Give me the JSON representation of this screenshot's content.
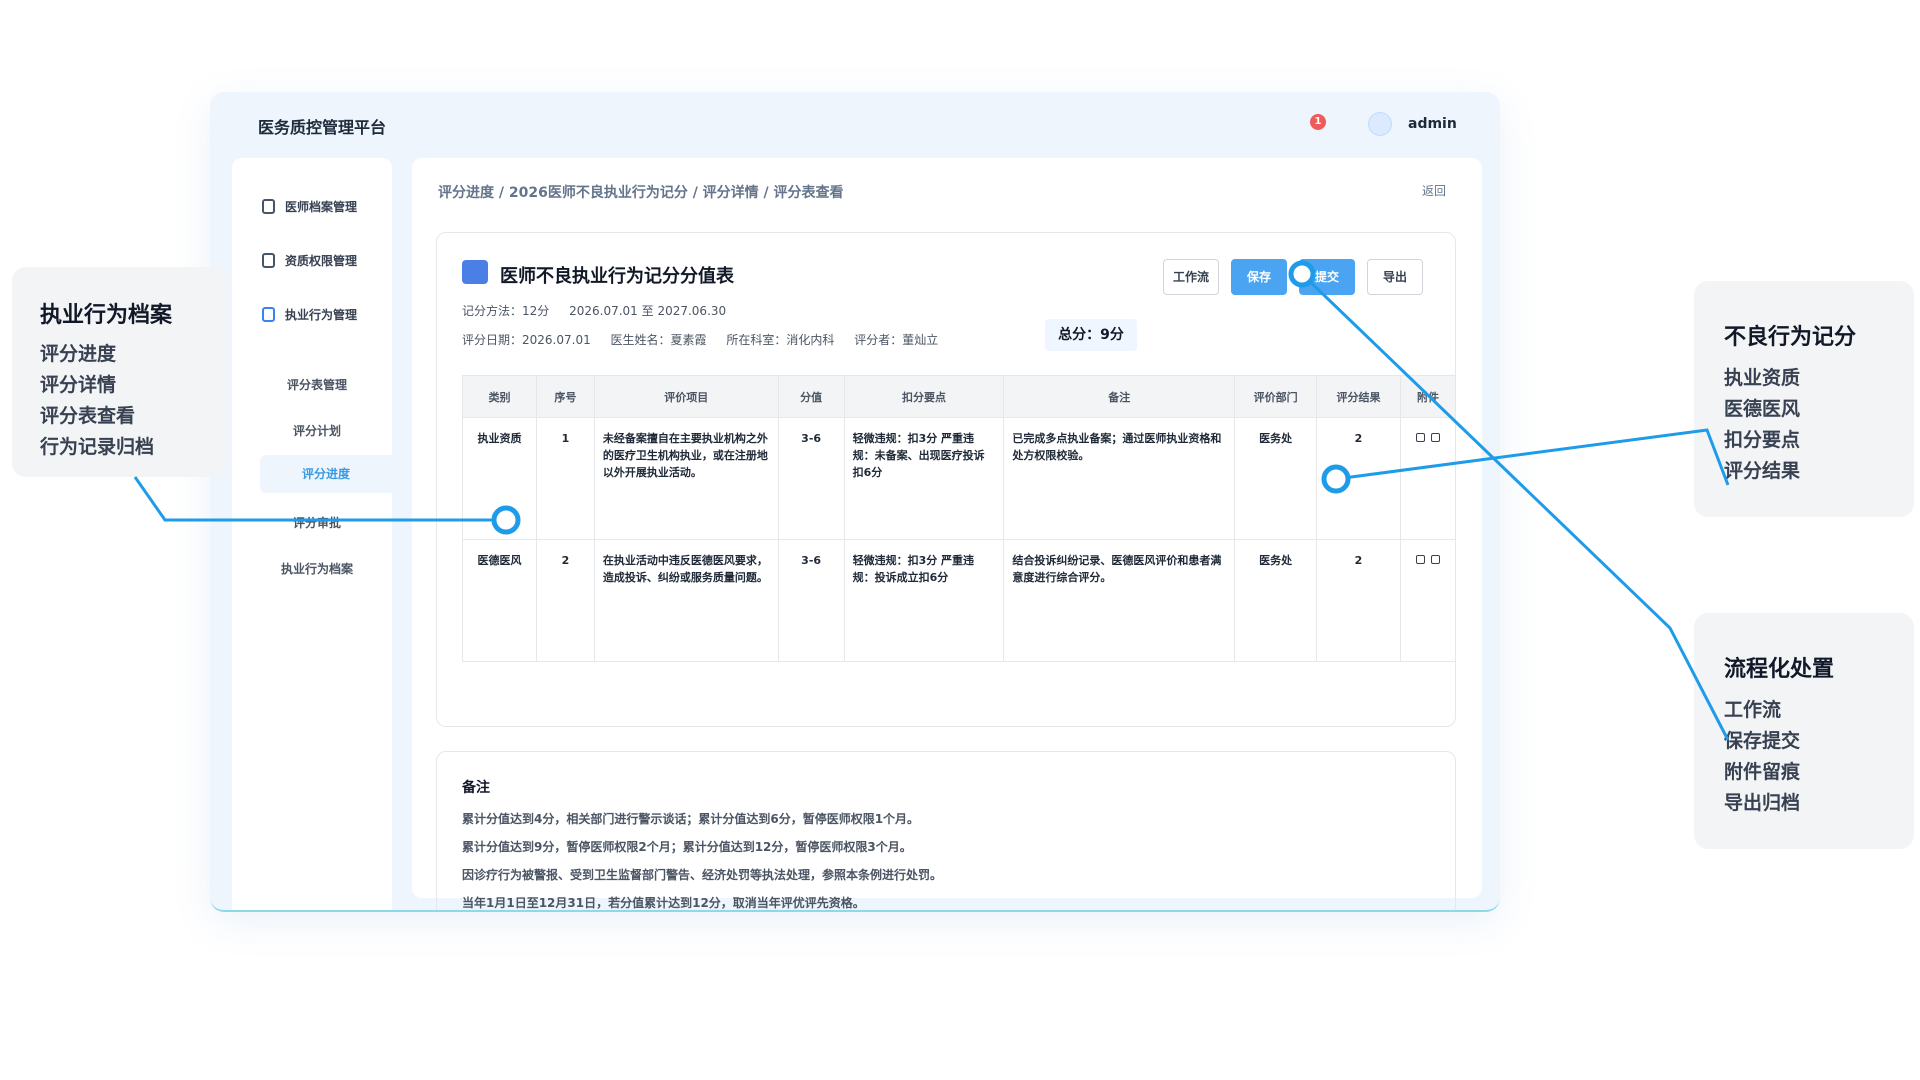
{
  "app": {
    "title": "医务质控管理平台",
    "notification_count": "1",
    "username": "admin"
  },
  "sidebar": {
    "items": [
      {
        "label": "医师档案管理"
      },
      {
        "label": "资质权限管理"
      },
      {
        "label": "执业行为管理"
      }
    ],
    "subitems": [
      {
        "label": "评分表管理"
      },
      {
        "label": "评分计划"
      },
      {
        "label": "评分进度"
      },
      {
        "label": "评分审批"
      },
      {
        "label": "执业行为档案"
      }
    ]
  },
  "breadcrumb": "评分进度 / 2026医师不良执业行为记分 / 评分详情 / 评分表查看",
  "back_label": "返回",
  "card": {
    "title": "医师不良执业行为记分分值表",
    "method": "记分方法：12分",
    "period": "2026.07.01 至 2027.06.30",
    "eval_date": "评分日期：2026.07.01",
    "doctor": "医生姓名：夏素霞",
    "dept": "所在科室：消化内科",
    "evaluator": "评分者：董灿立",
    "total": "总分：9分",
    "buttons": {
      "workflow": "工作流",
      "save": "保存",
      "submit": "提交",
      "export": "导出"
    }
  },
  "table": {
    "headers": [
      "类别",
      "序号",
      "评价项目",
      "分值",
      "扣分要点",
      "备注",
      "评价部门",
      "评分结果",
      "附件"
    ],
    "rows": [
      {
        "category": "执业资质",
        "no": "1",
        "item": "未经备案擅自在主要执业机构之外的医疗卫生机构执业，或在注册地以外开展执业活动。",
        "score": "3-6",
        "points": "轻微违规：扣3分 严重违规：未备案、出现医疗投诉扣6分",
        "remark": "已完成多点执业备案；通过医师执业资格和处方权限校验。",
        "dept": "医务处",
        "result": "2"
      },
      {
        "category": "医德医风",
        "no": "2",
        "item": "在执业活动中违反医德医风要求，造成投诉、纠纷或服务质量问题。",
        "score": "3-6",
        "points": "轻微违规：扣3分 严重违规：投诉成立扣6分",
        "remark": "结合投诉纠纷记录、医德医风评价和患者满意度进行综合评分。",
        "dept": "医务处",
        "result": "2"
      }
    ]
  },
  "notes": {
    "title": "备注",
    "lines": [
      "累计分值达到4分，相关部门进行警示谈话；累计分值达到6分，暂停医师权限1个月。",
      "累计分值达到9分，暂停医师权限2个月；累计分值达到12分，暂停医师权限3个月。",
      "因诊疗行为被警报、受到卫生监督部门警告、经济处罚等执法处理，参照本条例进行处罚。",
      "当年1月1日至12月31日，若分值累计达到12分，取消当年评优评先资格。"
    ]
  },
  "callouts": {
    "left": {
      "title": "执业行为档案",
      "items": [
        "评分进度",
        "评分详情",
        "评分表查看",
        "行为记录归档"
      ]
    },
    "right_top": {
      "title": "不良行为记分",
      "items": [
        "执业资质",
        "医德医风",
        "扣分要点",
        "评分结果"
      ]
    },
    "right_bottom": {
      "title": "流程化处置",
      "items": [
        "工作流",
        "保存提交",
        "附件留痕",
        "导出归档"
      ]
    }
  },
  "colors": {
    "accent": "#4aa4f2",
    "line": "#1e9be9",
    "brand_icon": "#4a7fe6",
    "badge": "#ef5b5b"
  }
}
